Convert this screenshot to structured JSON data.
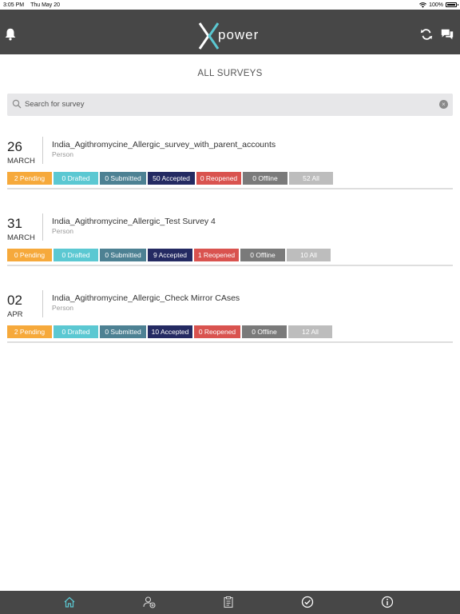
{
  "status_bar": {
    "time": "3:05 PM",
    "date": "Thu May 20",
    "battery": "100%"
  },
  "header": {
    "logo_text": "power",
    "icons": [
      "bell-icon",
      "sync-icon",
      "chat-icon"
    ]
  },
  "page": {
    "title": "ALL SURVEYS"
  },
  "search": {
    "placeholder": "Search for survey",
    "clear_icon": "×"
  },
  "surveys": [
    {
      "day": "26",
      "month": "MARCH",
      "name": "India_Agithromycine_Allergic_survey_with_parent_accounts",
      "type": "Person",
      "chips": {
        "pending": "2 Pending",
        "drafted": "0 Drafted",
        "submitted": "0 Submitted",
        "accepted": "50 Accepted",
        "reopened": "0 Reopened",
        "offline": "0 Offline",
        "all": "52 All"
      }
    },
    {
      "day": "31",
      "month": "MARCH",
      "name": "India_Agithromycine_Allergic_Test Survey 4",
      "type": "Person",
      "chips": {
        "pending": "0 Pending",
        "drafted": "0 Drafted",
        "submitted": "0 Submitted",
        "accepted": "9 Accepted",
        "reopened": "1 Reopened",
        "offline": "0 Offline",
        "all": "10 All"
      }
    },
    {
      "day": "02",
      "month": "APR",
      "name": "India_Agithromycine_Allergic_Check Mirror CAses",
      "type": "Person",
      "chips": {
        "pending": "2 Pending",
        "drafted": "0 Drafted",
        "submitted": "0 Submitted",
        "accepted": "10 Accepted",
        "reopened": "0 Reopened",
        "offline": "0 Offline",
        "all": "12 All"
      }
    }
  ],
  "chip_colors": {
    "pending": "#f6a93b",
    "drafted": "#5bc8d2",
    "submitted": "#4d8193",
    "accepted": "#242a62",
    "reopened": "#d9534f",
    "offline": "#7a7a7a",
    "all": "#bdbdbd"
  },
  "tab_bar": {
    "active_color": "#5bc8d2",
    "tabs": [
      "home-icon",
      "user-add-icon",
      "clipboard-icon",
      "check-circle-icon",
      "info-icon"
    ]
  }
}
